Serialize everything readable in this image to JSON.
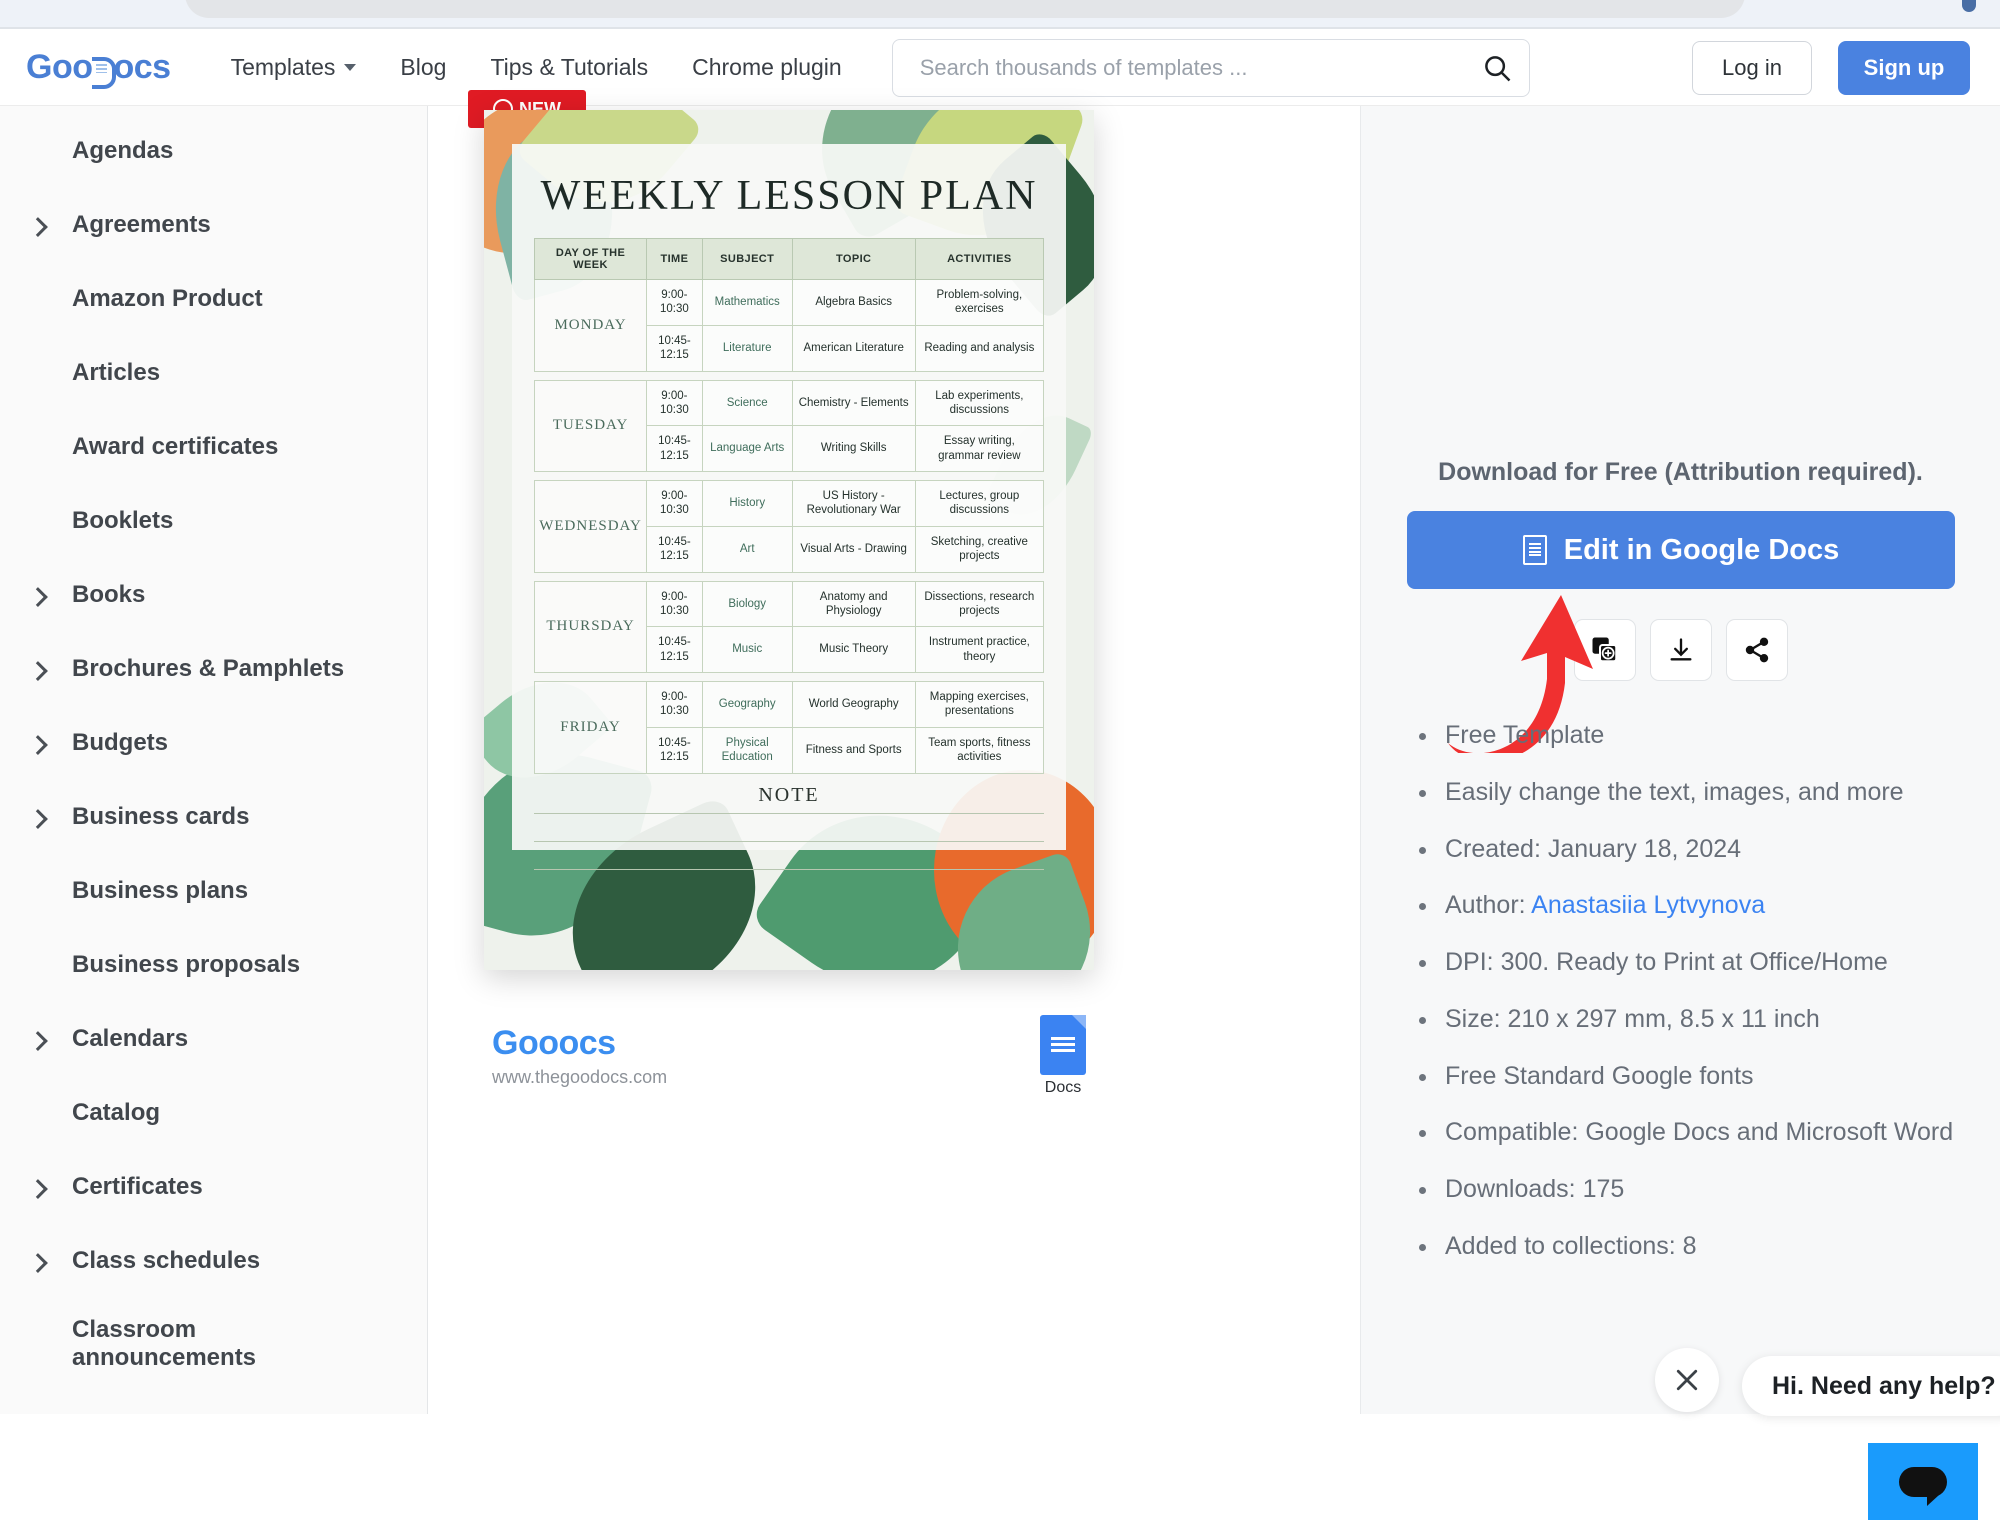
{
  "browser": {
    "omnibox_visible": true
  },
  "header": {
    "logo_prefix": "Goo",
    "logo_suffix": "ocs",
    "nav": [
      {
        "label": "Templates",
        "has_caret": true,
        "icon": "chevron-down-icon"
      },
      {
        "label": "Blog",
        "has_caret": false
      },
      {
        "label": "Tips & Tutorials",
        "has_caret": false
      },
      {
        "label": "Chrome plugin",
        "has_caret": false
      }
    ],
    "search": {
      "placeholder": "Search thousands of templates ...",
      "value": "",
      "icon": "search-icon"
    },
    "login_label": "Log in",
    "signup_label": "Sign up",
    "signup_color": "#4a82e0"
  },
  "sidebar": {
    "items": [
      {
        "label": "Agendas",
        "expandable": false
      },
      {
        "label": "Agreements",
        "expandable": true
      },
      {
        "label": "Amazon Product",
        "expandable": false
      },
      {
        "label": "Articles",
        "expandable": false
      },
      {
        "label": "Award certificates",
        "expandable": false
      },
      {
        "label": "Booklets",
        "expandable": false
      },
      {
        "label": "Books",
        "expandable": true
      },
      {
        "label": "Brochures & Pamphlets",
        "expandable": true
      },
      {
        "label": "Budgets",
        "expandable": true
      },
      {
        "label": "Business cards",
        "expandable": true
      },
      {
        "label": "Business plans",
        "expandable": false
      },
      {
        "label": "Business proposals",
        "expandable": false
      },
      {
        "label": "Calendars",
        "expandable": true
      },
      {
        "label": "Catalog",
        "expandable": false
      },
      {
        "label": "Certificates",
        "expandable": true
      },
      {
        "label": "Class schedules",
        "expandable": true
      },
      {
        "label": "Classroom announcements",
        "expandable": false
      }
    ]
  },
  "preview": {
    "badge_label": "NEW",
    "doc_title": "WEEKLY LESSON PLAN",
    "table": {
      "headers": [
        "DAY OF THE WEEK",
        "TIME",
        "SUBJECT",
        "TOPIC",
        "ACTIVITIES"
      ],
      "days": [
        {
          "day": "MONDAY",
          "rows": [
            {
              "time": "9:00-10:30",
              "subject": "Mathematics",
              "topic": "Algebra Basics",
              "activities": "Problem-solving, exercises"
            },
            {
              "time": "10:45-12:15",
              "subject": "Literature",
              "topic": "American Literature",
              "activities": "Reading and analysis"
            }
          ]
        },
        {
          "day": "TUESDAY",
          "rows": [
            {
              "time": "9:00-10:30",
              "subject": "Science",
              "topic": "Chemistry - Elements",
              "activities": "Lab experiments, discussions"
            },
            {
              "time": "10:45-12:15",
              "subject": "Language Arts",
              "topic": "Writing Skills",
              "activities": "Essay writing, grammar review"
            }
          ]
        },
        {
          "day": "WEDNESDAY",
          "rows": [
            {
              "time": "9:00-10:30",
              "subject": "History",
              "topic": "US History - Revolutionary War",
              "activities": "Lectures, group discussions"
            },
            {
              "time": "10:45-12:15",
              "subject": "Art",
              "topic": "Visual Arts - Drawing",
              "activities": "Sketching, creative projects"
            }
          ]
        },
        {
          "day": "THURSDAY",
          "rows": [
            {
              "time": "9:00-10:30",
              "subject": "Biology",
              "topic": "Anatomy and Physiology",
              "activities": "Dissections, research projects"
            },
            {
              "time": "10:45-12:15",
              "subject": "Music",
              "topic": "Music Theory",
              "activities": "Instrument practice, theory"
            }
          ]
        },
        {
          "day": "FRIDAY",
          "rows": [
            {
              "time": "9:00-10:30",
              "subject": "Geography",
              "topic": "World Geography",
              "activities": "Mapping exercises, presentations"
            },
            {
              "time": "10:45-12:15",
              "subject": "Physical Education",
              "topic": "Fitness and Sports",
              "activities": "Team sports, fitness activities"
            }
          ]
        }
      ]
    },
    "note_title": "NOTE",
    "note_lines": 3,
    "footer": {
      "logo_prefix": "Goo",
      "logo_suffix": "ocs",
      "url": "www.thegoodocs.com",
      "docs_label": "Docs"
    }
  },
  "info_panel": {
    "download_heading": "Download for Free (Attribution required).",
    "edit_button_label": "Edit in Google Docs",
    "actions": [
      {
        "name": "add-to-collection-button",
        "icon": "copy-plus-icon"
      },
      {
        "name": "download-button",
        "icon": "download-icon"
      },
      {
        "name": "share-button",
        "icon": "share-icon"
      }
    ],
    "annotation": {
      "type": "red-arrow",
      "color": "#f03030",
      "points_to": "download-button"
    },
    "features": [
      {
        "text": "Free Template"
      },
      {
        "text": "Easily change the text, images, and more"
      },
      {
        "text": "Created: January 18, 2024"
      },
      {
        "text": "Author: ",
        "link": "Anastasiia Lytvynova"
      },
      {
        "text": "DPI: 300. Ready to Print at Office/Home"
      },
      {
        "text": "Size: 210 x 297 mm, 8.5 x 11 inch"
      },
      {
        "text": "Free Standard Google fonts"
      },
      {
        "text": "Compatible: Google Docs and Microsoft Word"
      },
      {
        "text": "Downloads: 175"
      },
      {
        "text": "Added to collections: 8"
      }
    ]
  },
  "chat_widget": {
    "message": "Hi. Need any help?",
    "close_icon": "close-icon",
    "launcher_icon": "chat-bubble-icon",
    "launcher_color": "#1a9bfc"
  }
}
